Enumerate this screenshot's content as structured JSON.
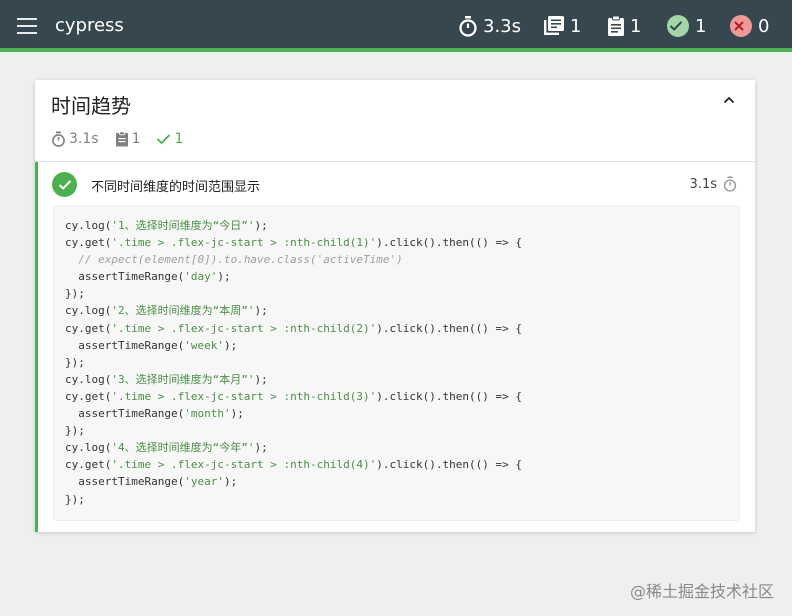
{
  "topbar": {
    "brand": "cypress",
    "duration": "3.3s",
    "suites": "1",
    "tests": "1",
    "passes": "1",
    "failures": "0",
    "colors": {
      "bar": "#37474f",
      "accent": "#4caf50",
      "pass": "#a5d6a7",
      "fail": "#ef9a9a"
    }
  },
  "suite": {
    "title": "时间趋势",
    "duration": "3.1s",
    "tests": "1",
    "passes": "1"
  },
  "test": {
    "title": "不同时间维度的时间范围显示",
    "duration": "3.1s"
  },
  "code": {
    "lines": [
      [
        {
          "t": "cy.log("
        },
        {
          "t": "'1、选择时间维度为“今日”'",
          "k": "s"
        },
        {
          "t": ");"
        }
      ],
      [
        {
          "t": "cy.get("
        },
        {
          "t": "'.time > .flex-jc-start > :nth-child(1)'",
          "k": "s"
        },
        {
          "t": ").click().then(() => {"
        }
      ],
      [
        {
          "t": "  "
        },
        {
          "t": "// expect(element[0]).to.have.class('activeTime')",
          "k": "c"
        }
      ],
      [
        {
          "t": "  assertTimeRange("
        },
        {
          "t": "'day'",
          "k": "s"
        },
        {
          "t": ");"
        }
      ],
      [
        {
          "t": "});"
        }
      ],
      [
        {
          "t": "cy.log("
        },
        {
          "t": "'2、选择时间维度为“本周”'",
          "k": "s"
        },
        {
          "t": ");"
        }
      ],
      [
        {
          "t": "cy.get("
        },
        {
          "t": "'.time > .flex-jc-start > :nth-child(2)'",
          "k": "s"
        },
        {
          "t": ").click().then(() => {"
        }
      ],
      [
        {
          "t": "  assertTimeRange("
        },
        {
          "t": "'week'",
          "k": "s"
        },
        {
          "t": ");"
        }
      ],
      [
        {
          "t": "});"
        }
      ],
      [
        {
          "t": "cy.log("
        },
        {
          "t": "'3、选择时间维度为“本月”'",
          "k": "s"
        },
        {
          "t": ");"
        }
      ],
      [
        {
          "t": "cy.get("
        },
        {
          "t": "'.time > .flex-jc-start > :nth-child(3)'",
          "k": "s"
        },
        {
          "t": ").click().then(() => {"
        }
      ],
      [
        {
          "t": "  assertTimeRange("
        },
        {
          "t": "'month'",
          "k": "s"
        },
        {
          "t": ");"
        }
      ],
      [
        {
          "t": "});"
        }
      ],
      [
        {
          "t": "cy.log("
        },
        {
          "t": "'4、选择时间维度为“今年”'",
          "k": "s"
        },
        {
          "t": ");"
        }
      ],
      [
        {
          "t": "cy.get("
        },
        {
          "t": "'.time > .flex-jc-start > :nth-child(4)'",
          "k": "s"
        },
        {
          "t": ").click().then(() => {"
        }
      ],
      [
        {
          "t": "  assertTimeRange("
        },
        {
          "t": "'year'",
          "k": "s"
        },
        {
          "t": ");"
        }
      ],
      [
        {
          "t": "});"
        }
      ]
    ]
  },
  "watermark": "@稀土掘金技术社区"
}
